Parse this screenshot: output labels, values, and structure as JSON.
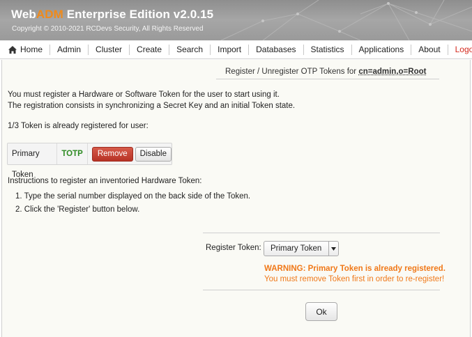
{
  "header": {
    "brand_prefix": "Web",
    "brand_highlight": "ADM",
    "brand_rest": " Enterprise Edition v2.0.15",
    "copyright": "Copyright © 2010-2021 RCDevs Security, All Rights Reserved"
  },
  "nav": {
    "items": [
      {
        "label": "Home",
        "icon": "home-icon"
      },
      {
        "label": "Admin"
      },
      {
        "label": "Cluster"
      },
      {
        "label": "Create"
      },
      {
        "label": "Search"
      },
      {
        "label": "Import"
      },
      {
        "label": "Databases"
      },
      {
        "label": "Statistics"
      },
      {
        "label": "Applications"
      },
      {
        "label": "About"
      },
      {
        "label": "Logout",
        "color": "#d42a1e"
      }
    ]
  },
  "subheader": {
    "text": "Register / Unregister OTP Tokens for ",
    "dn": "cn=admin,o=Root"
  },
  "intro": {
    "line1": "You must register a Hardware or Software Token for the user to start using it.",
    "line2": "The registration consists in synchronizing a Secret Key and an initial Token state.",
    "status": "1/3 Token is already registered for user:"
  },
  "token": {
    "name": "Primary Token",
    "type": "TOTP",
    "remove_label": "Remove",
    "disable_label": "Disable"
  },
  "instructions": {
    "heading": "Instructions to register an inventoried Hardware Token:",
    "steps": [
      "1.  Type the serial number displayed on the back side of the Token.",
      "2.  Click the 'Register' button below."
    ]
  },
  "register": {
    "label": "Register Token:",
    "selected": "Primary Token",
    "warning_title": "WARNING: Primary Token is already registered.",
    "warning_detail": "You must remove Token first in order to re-register!",
    "ok_label": "Ok"
  },
  "colors": {
    "accent": "#f08a1a",
    "logout": "#d42a1e",
    "totp": "#2e8b23",
    "warning": "#f07818",
    "remove_button": "#c1392b"
  }
}
